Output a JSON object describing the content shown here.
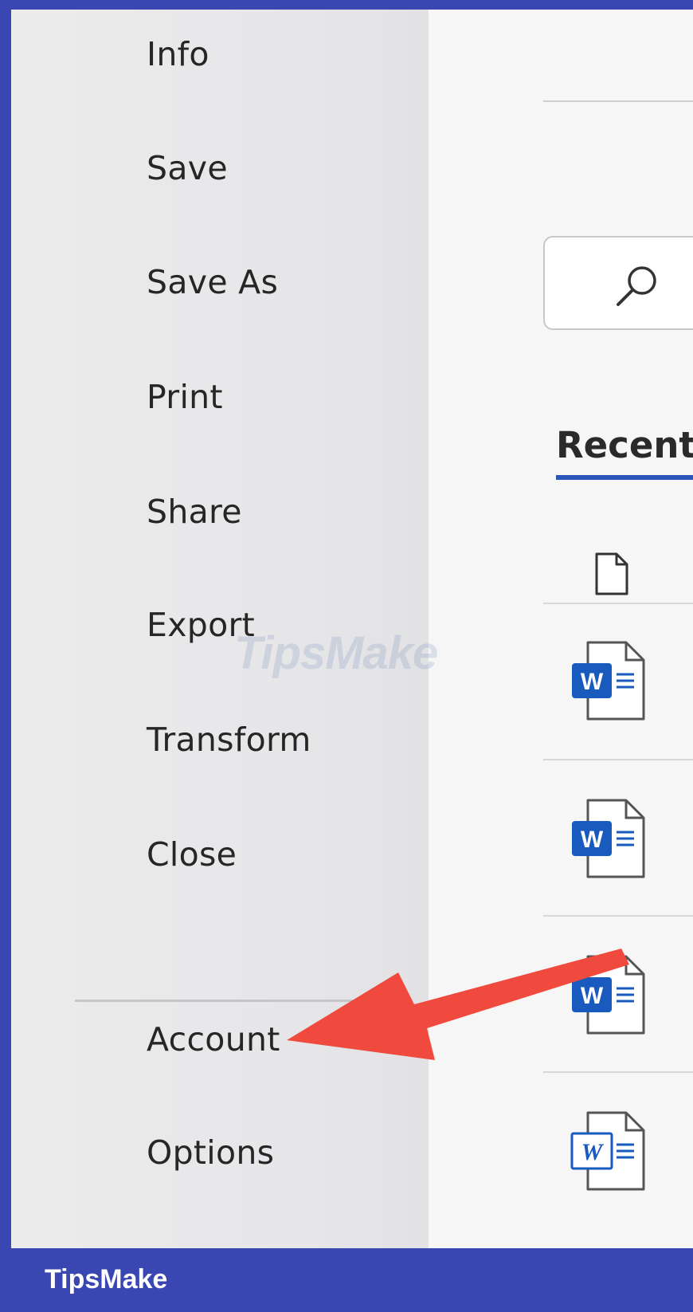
{
  "backstage_menu": {
    "items": [
      {
        "label": "Info"
      },
      {
        "label": "Save"
      },
      {
        "label": "Save As"
      },
      {
        "label": "Print"
      },
      {
        "label": "Share"
      },
      {
        "label": "Export"
      },
      {
        "label": "Transform"
      },
      {
        "label": "Close"
      },
      {
        "label": "Account"
      },
      {
        "label": "Options"
      }
    ]
  },
  "main": {
    "search_icon": "search-icon",
    "tabs": [
      {
        "label": "Recent",
        "active": true
      }
    ],
    "file_column_icon": "file-icon",
    "recent_files": [
      {
        "icon": "word-doc-icon"
      },
      {
        "icon": "word-doc-icon"
      },
      {
        "icon": "word-doc-icon"
      },
      {
        "icon": "word-doc-icon"
      }
    ]
  },
  "annotation": {
    "type": "arrow",
    "points_to": "Account",
    "color": "#f04a3e"
  },
  "watermark": {
    "text": "TipsMake"
  },
  "footer": {
    "brand": "TipsMake"
  },
  "colors": {
    "accent": "#2b56b8",
    "frame": "#3a47b2",
    "word_blue": "#185abd",
    "arrow": "#f04a3e"
  }
}
